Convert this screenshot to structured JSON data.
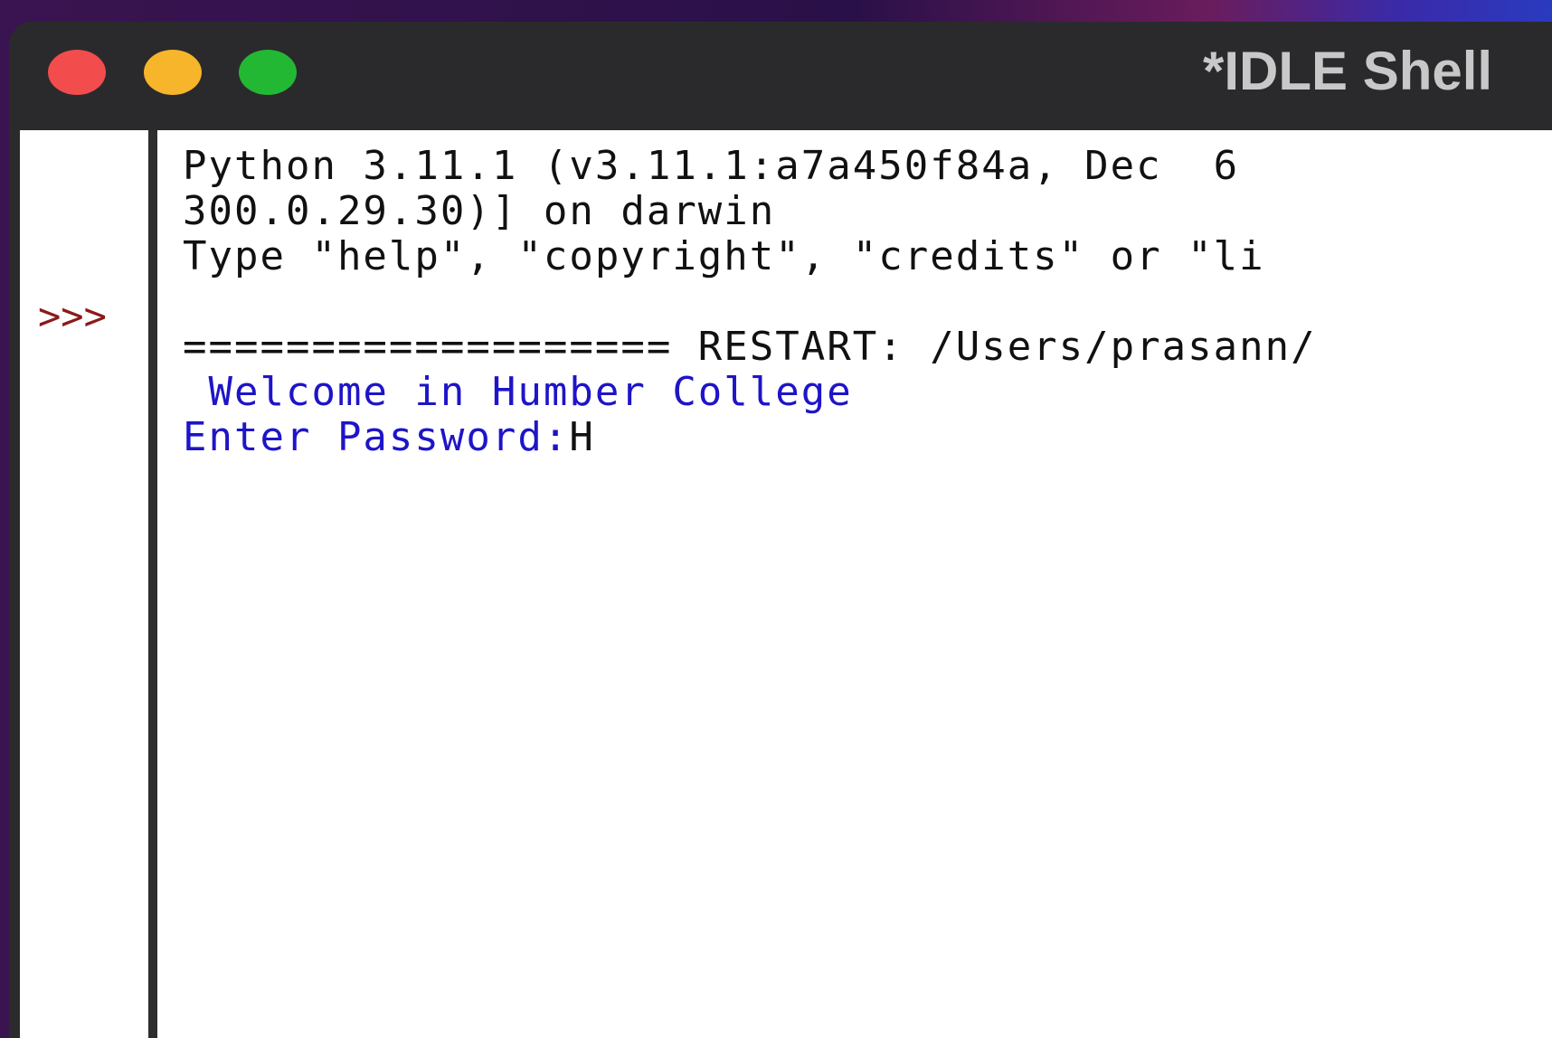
{
  "window": {
    "title": "*IDLE Shell",
    "controls": {
      "close": "close-button",
      "minimize": "minimize-button",
      "zoom": "zoom-button"
    },
    "colors": {
      "close": "#f24c4c",
      "minimize": "#f6b52a",
      "zoom": "#22b833",
      "titlebar": "#2a2a2c"
    }
  },
  "shell": {
    "prompt": ">>>",
    "banner_line1": "Python 3.11.1 (v3.11.1:a7a450f84a, Dec  6",
    "banner_line2": "300.0.29.30)] on darwin",
    "banner_line3": "Type \"help\", \"copyright\", \"credits\" or \"li",
    "restart_line": "=================== RESTART: /Users/prasann/",
    "output_welcome": " Welcome in Humber College",
    "input_prompt": "Enter Password:",
    "input_value": "H",
    "colors": {
      "prompt": "#8b1a1a",
      "stdout": "#1e14c8",
      "text": "#111111"
    }
  }
}
